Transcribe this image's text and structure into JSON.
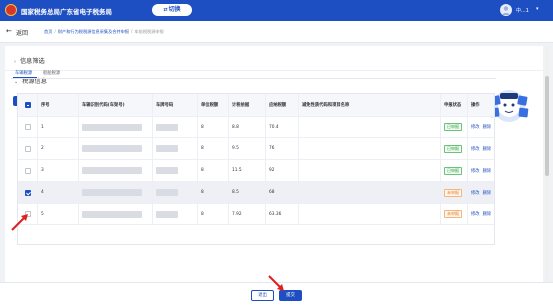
{
  "header": {
    "site_name": "国家税务总局广东省电子税务局",
    "switch_label": "切换",
    "user_name": "中...1"
  },
  "nav": {
    "back_label": "返回",
    "breadcrumbs": [
      "首页",
      "财产和行为税税源信息采集及合并申报",
      "车船税税源申报"
    ]
  },
  "sections": {
    "filter_title": "信息筛选",
    "source_title": "税源信息"
  },
  "toolbar": {
    "add_label": "新增税源",
    "import_label": "导入"
  },
  "tabs": [
    {
      "label": "车辆税源",
      "active": true
    },
    {
      "label": "船舶税源",
      "active": false
    }
  ],
  "table": {
    "headers": [
      "序号",
      "车辆识别代码(车架号)",
      "车牌号码",
      "单位税额",
      "计税依据",
      "应纳税额",
      "减免性质代码和项目名称",
      "申报状态",
      "操作"
    ],
    "rows": [
      {
        "no": "1",
        "unit_tax": "8",
        "basis": "8.8",
        "due": "70.4",
        "status": "已申报",
        "status_type": "ok",
        "checked": false
      },
      {
        "no": "2",
        "unit_tax": "8",
        "basis": "9.5",
        "due": "76",
        "status": "已申报",
        "status_type": "ok",
        "checked": false
      },
      {
        "no": "3",
        "unit_tax": "8",
        "basis": "11.5",
        "due": "92",
        "status": "已申报",
        "status_type": "ok",
        "checked": false
      },
      {
        "no": "4",
        "unit_tax": "8",
        "basis": "8.5",
        "due": "68",
        "status": "未申报",
        "status_type": "pending",
        "checked": true
      },
      {
        "no": "5",
        "unit_tax": "8",
        "basis": "7.92",
        "due": "63.36",
        "status": "未申报",
        "status_type": "pending",
        "checked": false
      }
    ],
    "actions": [
      "修改",
      "删除"
    ]
  },
  "footer": {
    "exit_label": "退出",
    "submit_label": "提交"
  },
  "mascot": {
    "text": "税务互动"
  },
  "colors": {
    "primary": "#1e4fc2",
    "ok": "#2a9b3c",
    "pending": "#e07a1f",
    "arrow": "#e02020"
  }
}
